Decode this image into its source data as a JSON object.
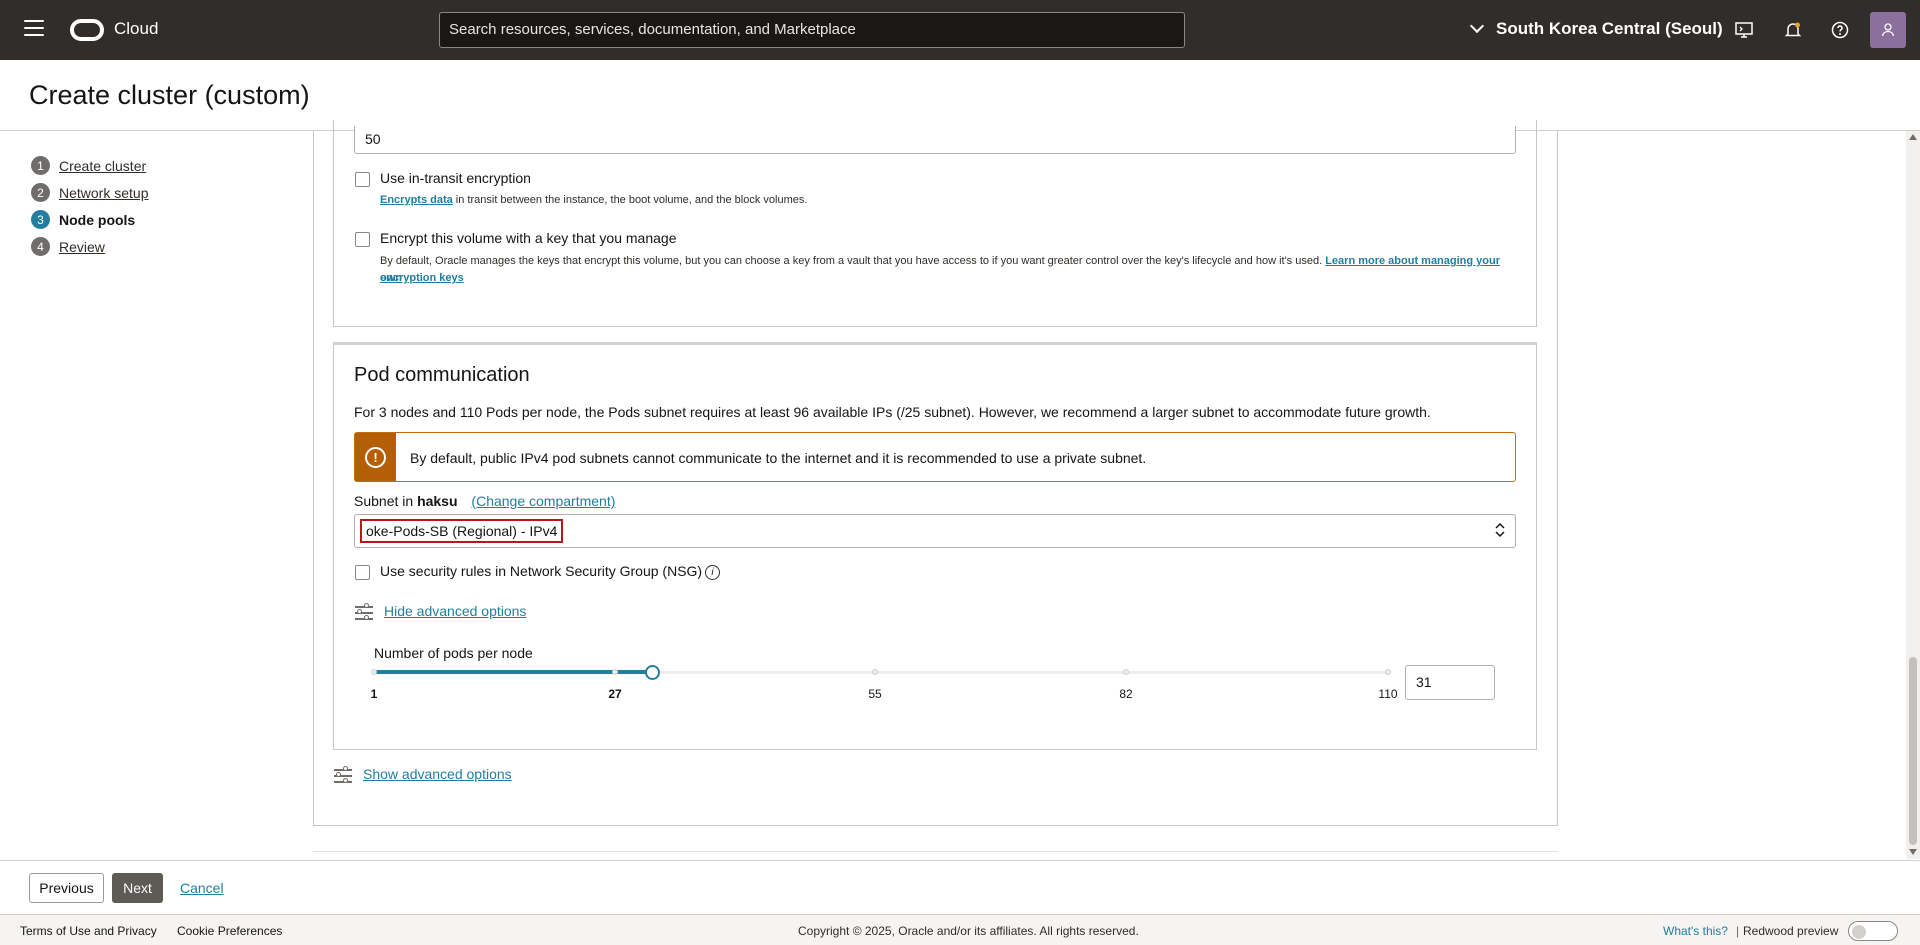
{
  "topbar": {
    "brand": "Cloud",
    "search_placeholder": "Search resources, services, documentation, and Marketplace",
    "region": "South Korea Central (Seoul)"
  },
  "page": {
    "title": "Create cluster (custom)"
  },
  "steps": [
    {
      "num": "1",
      "label": "Create cluster"
    },
    {
      "num": "2",
      "label": "Network setup"
    },
    {
      "num": "3",
      "label": "Node pools"
    },
    {
      "num": "4",
      "label": "Review"
    }
  ],
  "boot_volume": {
    "size_value": "50",
    "in_transit": {
      "label": "Use in-transit encryption",
      "link": "Encrypts data",
      "help_rest": " in transit between the instance, the boot volume, and the block volumes."
    },
    "own_key": {
      "label": "Encrypt this volume with a key that you manage",
      "help": "By default, Oracle manages the keys that encrypt this volume, but you can choose a key from a vault that you have access to if you want greater control over the key's lifecycle and how it's used. ",
      "link_line1": "Learn more about managing your own",
      "link_line2": "encryption keys"
    }
  },
  "pod_communication": {
    "title": "Pod communication",
    "description": "For 3 nodes and 110 Pods per node, the Pods subnet requires at least 96 available IPs (/25 subnet). However, we recommend a larger subnet to accommodate future growth.",
    "warning": "By default, public IPv4 pod subnets cannot communicate to the internet and it is recommended to use a private subnet.",
    "subnet_label_prefix": "Subnet in ",
    "compartment": "haksu",
    "change_compartment": "(Change compartment)",
    "subnet_value": "oke-Pods-SB (Regional) - IPv4",
    "nsg_label": "Use security rules in Network Security Group (NSG)",
    "hide_advanced": "Hide advanced options",
    "pods_per_node": {
      "label": "Number of pods per node",
      "min": 1,
      "max": 110,
      "value": 31,
      "value_text": "31",
      "ticks": [
        "1",
        "27",
        "55",
        "82",
        "110"
      ]
    }
  },
  "show_advanced": "Show advanced options",
  "actions": {
    "previous": "Previous",
    "next": "Next",
    "cancel": "Cancel"
  },
  "footer": {
    "terms": "Terms of Use and Privacy",
    "cookies": "Cookie Preferences",
    "copyright": "Copyright © 2025, Oracle and/or its affiliates. All rights reserved.",
    "whats_this": "What's this?",
    "separator": "|",
    "redwood": "Redwood preview"
  },
  "colors": {
    "accent": "#227e9e",
    "warning": "#b45f06",
    "highlight_border": "#c0141b",
    "topbar": "#312d2a"
  }
}
